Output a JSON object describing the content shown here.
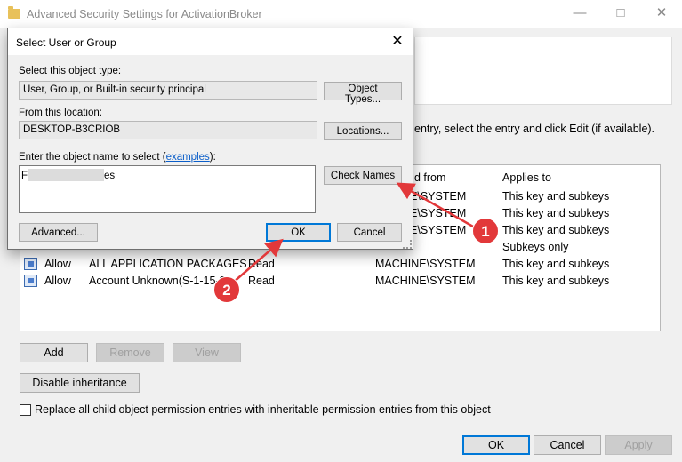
{
  "back_window": {
    "title": "Advanced Security Settings for ActivationBroker",
    "instructions": "entry, select the entry and click Edit (if available).",
    "columns": {
      "inherited_from": "d from",
      "applies_to": "Applies to"
    },
    "rows": [
      {
        "type": "",
        "principal": "",
        "access": "",
        "inherited_from": "NE\\SYSTEM",
        "applies_to": "This key and subkeys"
      },
      {
        "type": "",
        "principal": "",
        "access": "",
        "inherited_from": "NE\\SYSTEM",
        "applies_to": "This key and subkeys"
      },
      {
        "type": "",
        "principal": "",
        "access": "",
        "inherited_from": "NE\\SYSTEM",
        "applies_to": "This key and subkeys"
      },
      {
        "type": "",
        "principal": "",
        "access": "",
        "inherited_from": "",
        "applies_to": "Subkeys only"
      },
      {
        "type": "Allow",
        "principal": "ALL APPLICATION PACKAGES",
        "access": "Read",
        "inherited_from": "MACHINE\\SYSTEM",
        "applies_to": "This key and subkeys"
      },
      {
        "type": "Allow",
        "principal": "Account Unknown(S-1-15-3",
        "access": "Read",
        "inherited_from": "MACHINE\\SYSTEM",
        "applies_to": "This key and subkeys"
      }
    ],
    "buttons": {
      "add": "Add",
      "remove": "Remove",
      "view": "View",
      "disable_inheritance": "Disable inheritance",
      "ok": "OK",
      "cancel": "Cancel",
      "apply": "Apply"
    },
    "replace_checkbox_label": "Replace all child object permission entries with inheritable permission entries from this object",
    "replace_checked": false
  },
  "dialog": {
    "title": "Select User or Group",
    "object_type_label": "Select this object type:",
    "object_type_value": "User, Group, or Built-in security principal",
    "object_types_button": "Object Types...",
    "location_label": "From this location:",
    "location_value": "DESKTOP-B3CRIOB",
    "locations_button": "Locations...",
    "enter_label_prefix": "Enter the object name to select (",
    "enter_label_link": "examples",
    "enter_label_suffix": "):",
    "name_prefix": "F",
    "name_suffix": "es",
    "check_names_button": "Check Names",
    "advanced_button": "Advanced...",
    "ok_button": "OK",
    "cancel_button": "Cancel"
  },
  "callouts": [
    {
      "number": "1"
    },
    {
      "number": "2"
    }
  ],
  "colors": {
    "accent": "#0078d7",
    "callout": "#e2383a",
    "link": "#0b5ec9"
  },
  "icons": {
    "folder": "folder-icon",
    "entry": "permission-entry-icon",
    "close": "close-icon",
    "minimize": "minimize-icon",
    "maximize": "maximize-icon"
  }
}
